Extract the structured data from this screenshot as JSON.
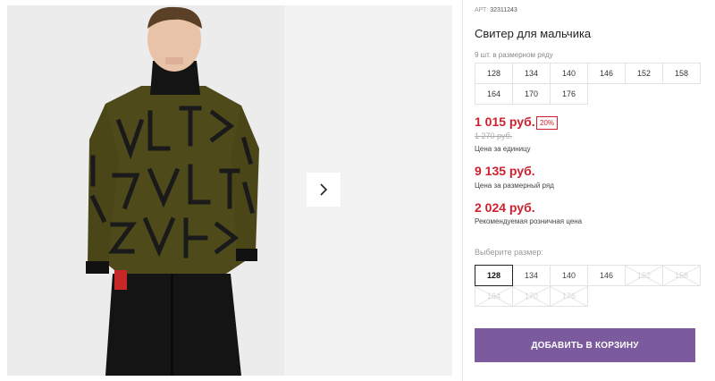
{
  "product": {
    "article_label": "АРТ:",
    "article_value": "32311243",
    "title": "Свитер для мальчика",
    "pack_note": "9 шт. в размерном ряду",
    "pack_sizes": [
      "128",
      "134",
      "140",
      "146",
      "152",
      "158",
      "164",
      "170",
      "176"
    ]
  },
  "pricing": {
    "unit_price": "1 015 руб.",
    "discount": "20%",
    "old_price": "1 270 руб.",
    "unit_note": "Цена за единицу",
    "row_price": "9 135 руб.",
    "row_note": "Цена за размерный ряд",
    "retail_price": "2 024 руб.",
    "retail_note": "Рекомендуемая розничная цена"
  },
  "size_select": {
    "label": "Выберите размер:",
    "options": [
      {
        "label": "128",
        "state": "selected"
      },
      {
        "label": "134",
        "state": "available"
      },
      {
        "label": "140",
        "state": "available"
      },
      {
        "label": "146",
        "state": "available"
      },
      {
        "label": "152",
        "state": "disabled"
      },
      {
        "label": "158",
        "state": "disabled"
      },
      {
        "label": "164",
        "state": "disabled"
      },
      {
        "label": "170",
        "state": "disabled"
      },
      {
        "label": "176",
        "state": "disabled"
      }
    ]
  },
  "cart": {
    "add_label": "ДОБАВИТЬ В КОРЗИНУ"
  },
  "gallery": {
    "next_icon": "chevron-right-icon"
  },
  "colors": {
    "price_red": "#d0202e",
    "button_purple": "#7b5b9e",
    "sweater_olive": "#4f4a1a"
  }
}
